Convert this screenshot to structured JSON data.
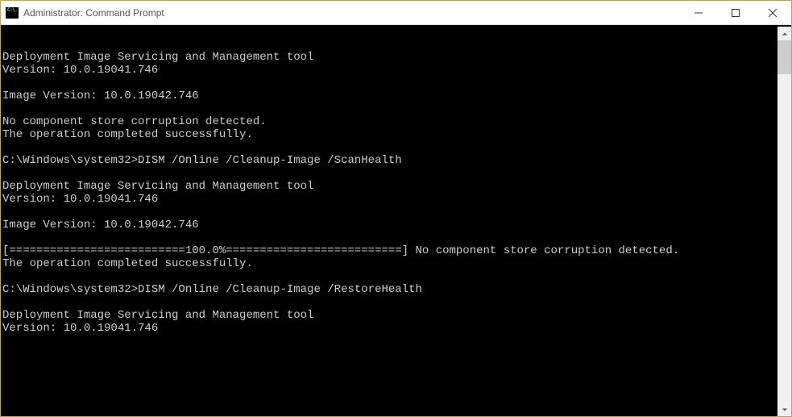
{
  "window": {
    "title": "Administrator: Command Prompt",
    "icon_label": "C:\\."
  },
  "console": {
    "lines": [
      "",
      "Deployment Image Servicing and Management tool",
      "Version: 10.0.19041.746",
      "",
      "Image Version: 10.0.19042.746",
      "",
      "No component store corruption detected.",
      "The operation completed successfully.",
      "",
      "C:\\Windows\\system32>DISM /Online /Cleanup-Image /ScanHealth",
      "",
      "Deployment Image Servicing and Management tool",
      "Version: 10.0.19041.746",
      "",
      "Image Version: 10.0.19042.746",
      "",
      "[==========================100.0%==========================] No component store corruption detected.",
      "The operation completed successfully.",
      "",
      "C:\\Windows\\system32>DISM /Online /Cleanup-Image /RestoreHealth",
      "",
      "Deployment Image Servicing and Management tool",
      "Version: 10.0.19041.746"
    ]
  }
}
